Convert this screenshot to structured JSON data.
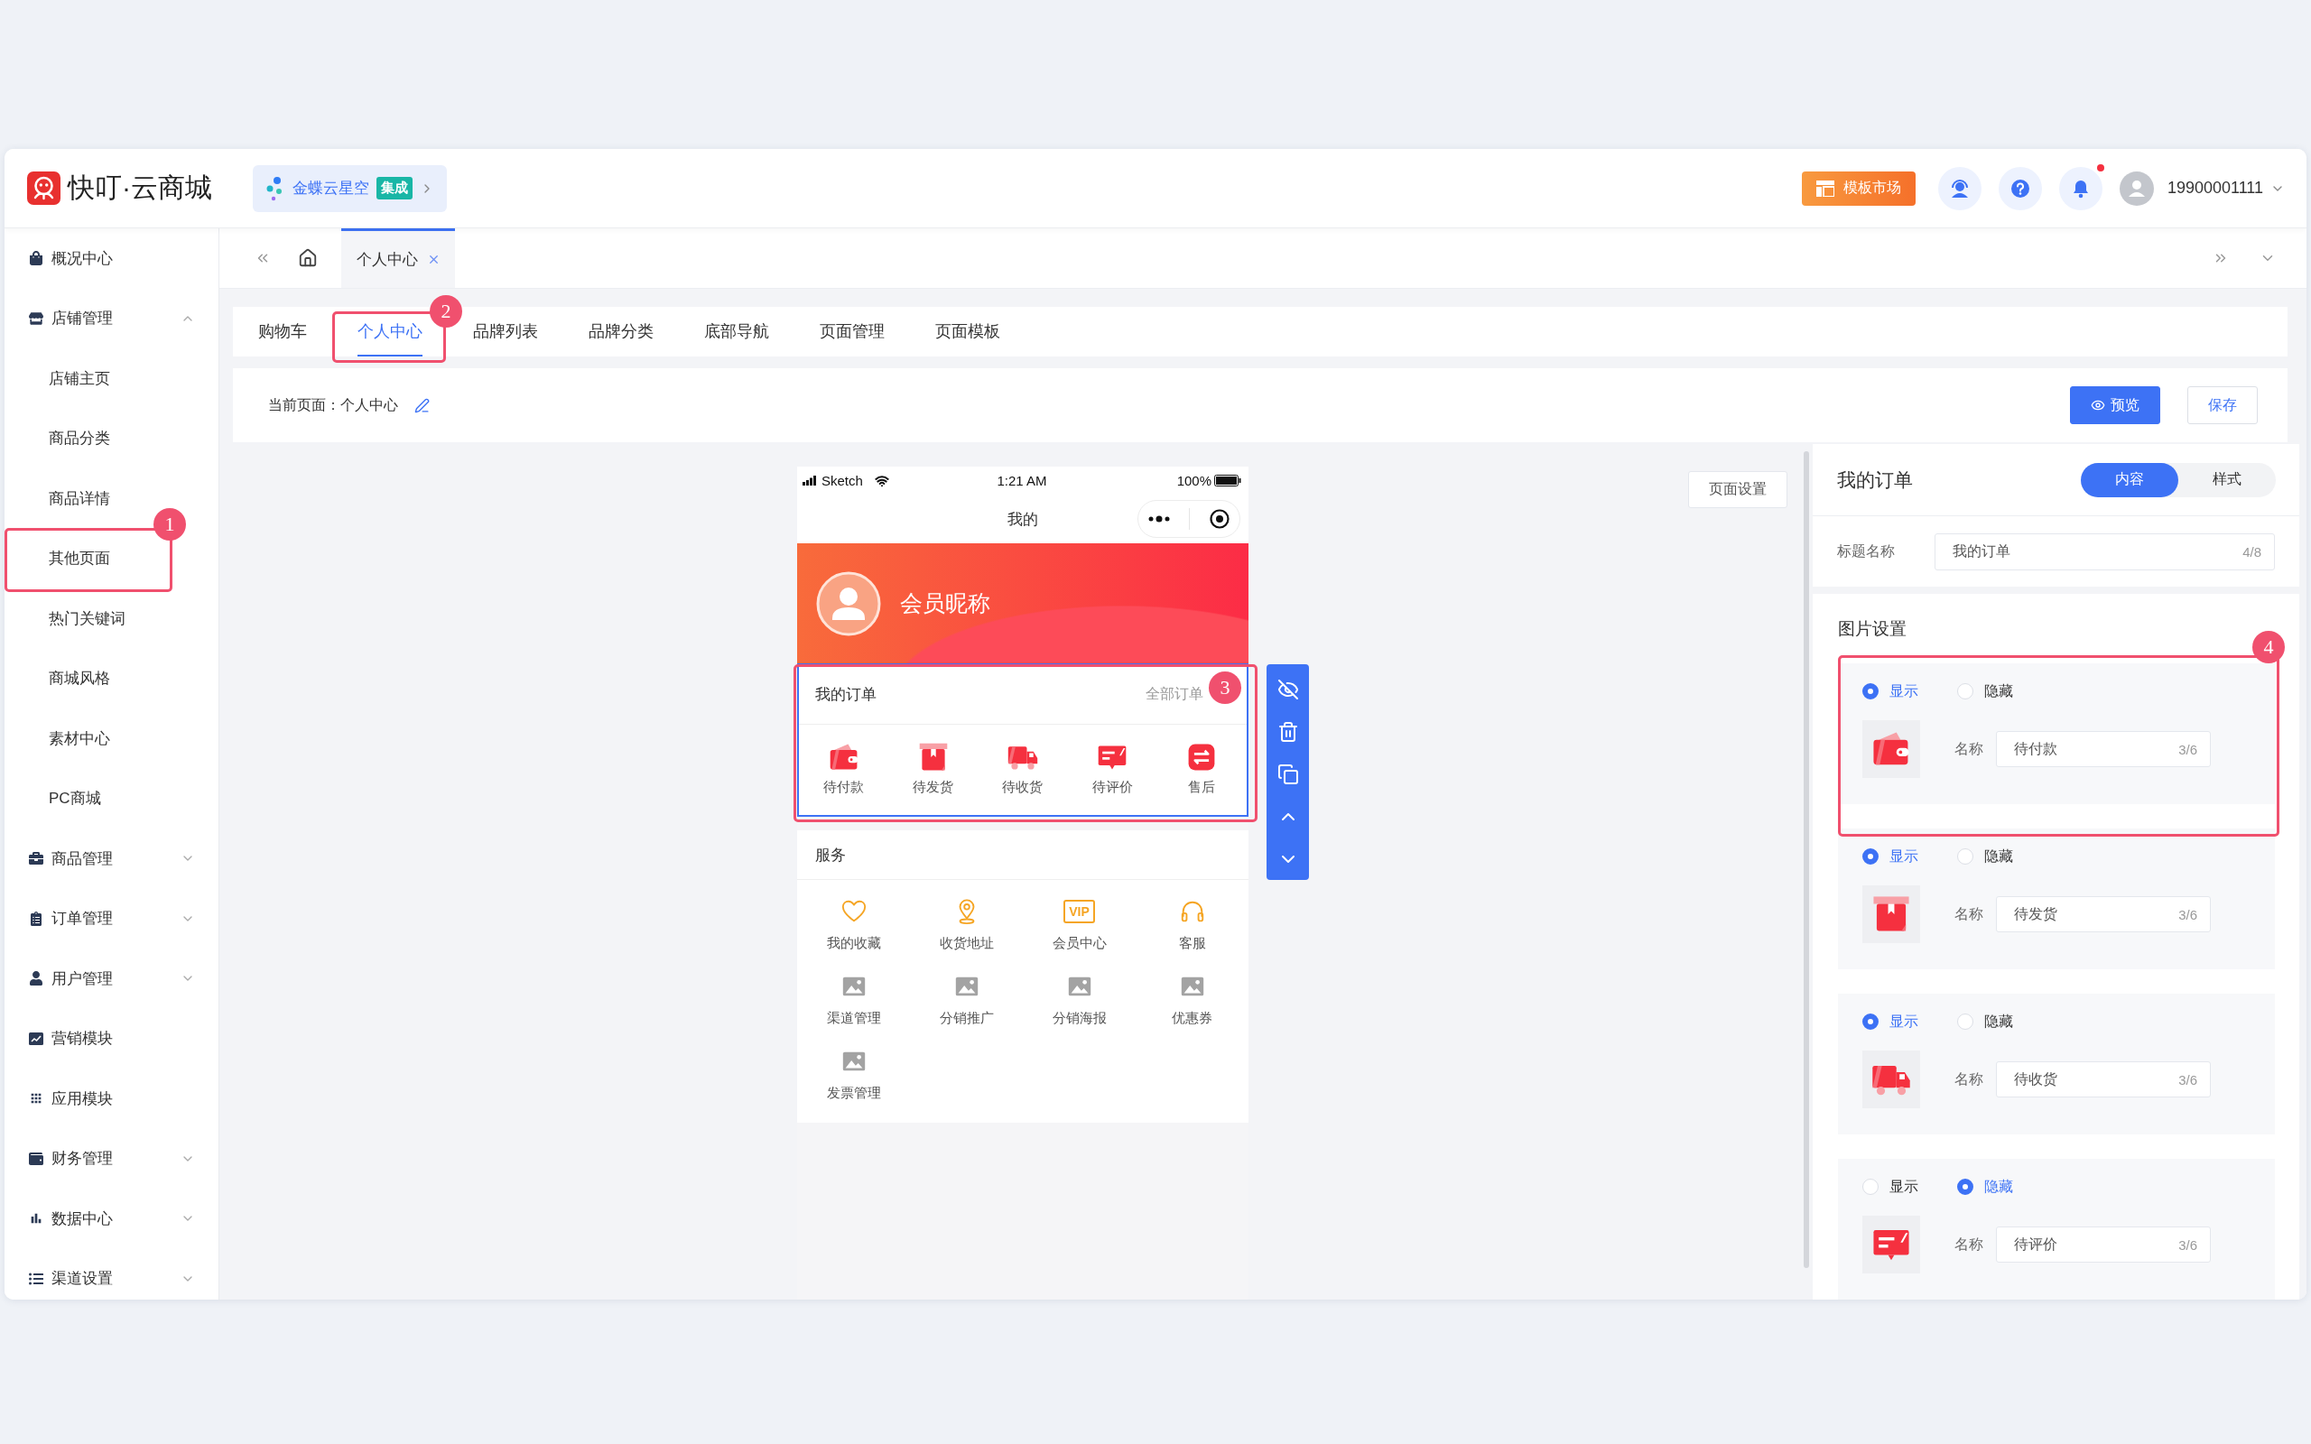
{
  "header": {
    "logo_text": "快叮·云商城",
    "integration": {
      "label": "金蝶云星空",
      "badge": "集成"
    },
    "template_button": "模板市场",
    "notifications": {
      "unread": true
    },
    "username": "19900001111"
  },
  "sidebar": {
    "items": [
      {
        "label": "概况中心"
      },
      {
        "label": "店铺管理",
        "expanded": true,
        "children": [
          {
            "label": "店铺主页"
          },
          {
            "label": "商品分类"
          },
          {
            "label": "商品详情"
          },
          {
            "label": "其他页面",
            "callout": "1"
          },
          {
            "label": "热门关键词"
          },
          {
            "label": "商城风格"
          },
          {
            "label": "素材中心"
          },
          {
            "label": "PC商城"
          }
        ]
      },
      {
        "label": "商品管理",
        "expanded": false
      },
      {
        "label": "订单管理",
        "expanded": false
      },
      {
        "label": "用户管理",
        "expanded": false
      },
      {
        "label": "营销模块"
      },
      {
        "label": "应用模块"
      },
      {
        "label": "财务管理",
        "expanded": false
      },
      {
        "label": "数据中心",
        "expanded": false
      },
      {
        "label": "渠道设置",
        "expanded": false
      }
    ]
  },
  "page_tabs": [
    {
      "label": "个人中心",
      "selected": true
    }
  ],
  "sub_tabs": [
    {
      "label": "购物车",
      "selected": false
    },
    {
      "label": "个人中心",
      "selected": true,
      "callout": "2"
    },
    {
      "label": "品牌列表",
      "selected": false
    },
    {
      "label": "品牌分类",
      "selected": false
    },
    {
      "label": "底部导航",
      "selected": false
    },
    {
      "label": "页面管理",
      "selected": false
    },
    {
      "label": "页面模板",
      "selected": false
    }
  ],
  "page_bar": {
    "current_page": "当前页面：个人中心",
    "buttons": [
      {
        "label": "预览",
        "kind": "primary"
      },
      {
        "label": "保存",
        "kind": "default"
      }
    ]
  },
  "canvas": {
    "page_settings": "页面设置",
    "phone": {
      "status": {
        "carrier": "Sketch",
        "time": "1:21 AM",
        "battery": "100%"
      },
      "title": "我的",
      "member_name": "会员昵称",
      "orders": {
        "title": "我的订单",
        "more": "全部订单",
        "selected": true,
        "callout": "3",
        "items": [
          {
            "label": "待付款"
          },
          {
            "label": "待发货"
          },
          {
            "label": "待收货"
          },
          {
            "label": "待评价"
          },
          {
            "label": "售后"
          }
        ]
      },
      "services": {
        "title": "服务",
        "items": [
          {
            "label": "我的收藏",
            "kind": "icon"
          },
          {
            "label": "收货地址",
            "kind": "icon"
          },
          {
            "label": "会员中心",
            "kind": "icon",
            "icon_text": "VIP"
          },
          {
            "label": "客服",
            "kind": "icon"
          },
          {
            "label": "渠道管理",
            "kind": "placeholder"
          },
          {
            "label": "分销推广",
            "kind": "placeholder"
          },
          {
            "label": "分销海报",
            "kind": "placeholder"
          },
          {
            "label": "优惠券",
            "kind": "placeholder"
          },
          {
            "label": "发票管理",
            "kind": "placeholder"
          }
        ]
      }
    }
  },
  "settings_panel": {
    "title": "我的订单",
    "modes": [
      {
        "label": "内容",
        "selected": true
      },
      {
        "label": "样式",
        "selected": false
      }
    ],
    "title_field": {
      "label": "标题名称",
      "value": "我的订单",
      "count": "4/8"
    },
    "images": {
      "title": "图片设置",
      "items": [
        {
          "options": [
            {
              "label": "显示",
              "selected": true
            },
            {
              "label": "隐藏",
              "selected": false
            }
          ],
          "name_label": "名称",
          "value": "待付款",
          "count": "3/6",
          "callout": "4"
        },
        {
          "options": [
            {
              "label": "显示",
              "selected": true
            },
            {
              "label": "隐藏",
              "selected": false
            }
          ],
          "name_label": "名称",
          "value": "待发货",
          "count": "3/6"
        },
        {
          "options": [
            {
              "label": "显示",
              "selected": true
            },
            {
              "label": "隐藏",
              "selected": false
            }
          ],
          "name_label": "名称",
          "value": "待收货",
          "count": "3/6"
        },
        {
          "options": [
            {
              "label": "显示",
              "selected": false
            },
            {
              "label": "隐藏",
              "selected": true
            }
          ],
          "name_label": "名称",
          "value": "待评价",
          "count": "3/6"
        }
      ]
    }
  }
}
